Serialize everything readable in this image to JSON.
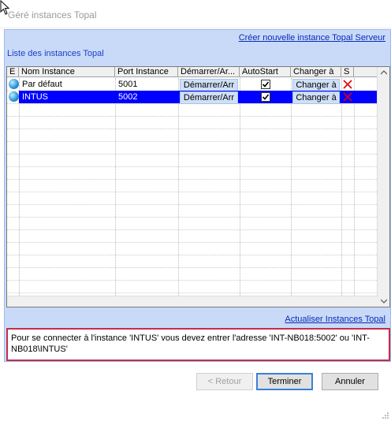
{
  "window": {
    "title": "Géré instances Topal"
  },
  "header": {
    "create_link": "Créer nouvelle instance Topal Serveur",
    "group_label": "Liste des instances Topal"
  },
  "grid": {
    "columns": [
      "E",
      "Nom Instance",
      "Port Instance",
      "Démarrer/Ar...",
      "AutoStart",
      "Changer à",
      "S"
    ],
    "rows": [
      {
        "name": "Par défaut",
        "port": "5001",
        "start_label": "Démarrer/Arr",
        "autostart": true,
        "change_label": "Changer à",
        "selected": false
      },
      {
        "name": "INTUS",
        "port": "5002",
        "start_label": "Démarrer/Arr",
        "autostart": true,
        "change_label": "Changer à",
        "selected": true
      }
    ]
  },
  "refresh_link": "Actualiser Instances Topal",
  "info_text": "Pour se connecter à l'instance 'INTUS' vous devez entrer l'adresse 'INT-NB018:5002' ou 'INT-NB018\\INTUS'",
  "buttons": {
    "back": "< Retour",
    "finish": "Terminer",
    "cancel": "Annuler"
  },
  "colors": {
    "panel_bg": "#c9daf8",
    "selection": "#0000ff",
    "link": "#0a2bb8",
    "info_border": "#c0304a",
    "delete_icon": "#e00000"
  }
}
